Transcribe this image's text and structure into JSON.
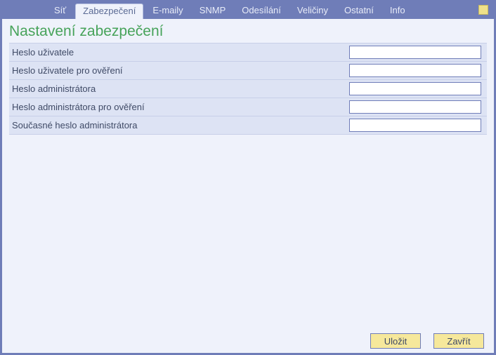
{
  "tabs": [
    {
      "id": "sit",
      "label": "Síť",
      "active": false
    },
    {
      "id": "zabezpeceni",
      "label": "Zabezpečení",
      "active": true
    },
    {
      "id": "emaily",
      "label": "E-maily",
      "active": false
    },
    {
      "id": "snmp",
      "label": "SNMP",
      "active": false
    },
    {
      "id": "odesilani",
      "label": "Odesílání",
      "active": false
    },
    {
      "id": "veliciny",
      "label": "Veličiny",
      "active": false
    },
    {
      "id": "ostatni",
      "label": "Ostatní",
      "active": false
    },
    {
      "id": "info",
      "label": "Info",
      "active": false
    }
  ],
  "page_title": "Nastavení zabezpečení",
  "form_rows": [
    {
      "name": "user-password",
      "label": "Heslo uživatele",
      "value": ""
    },
    {
      "name": "user-password-confirm",
      "label": "Heslo uživatele pro ověření",
      "value": ""
    },
    {
      "name": "admin-password",
      "label": "Heslo administrátora",
      "value": ""
    },
    {
      "name": "admin-password-confirm",
      "label": "Heslo administrátora pro ověření",
      "value": ""
    },
    {
      "name": "current-admin-password",
      "label": "Současné heslo administrátora",
      "value": ""
    }
  ],
  "buttons": {
    "save": "Uložit",
    "close": "Zavřít"
  }
}
